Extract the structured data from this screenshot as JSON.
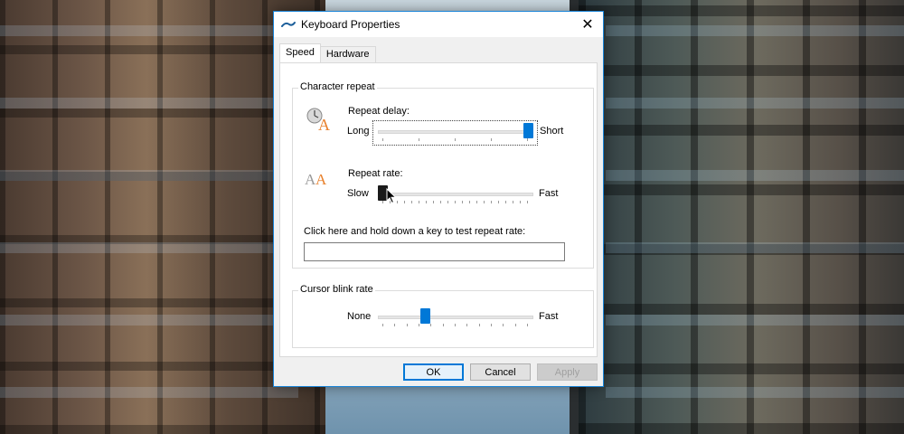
{
  "window": {
    "title": "Keyboard Properties",
    "close_glyph": "✕",
    "icon": "keyboard-icon"
  },
  "tabs": [
    {
      "label": "Speed",
      "active": true
    },
    {
      "label": "Hardware",
      "active": false
    }
  ],
  "character_repeat": {
    "group_label": "Character repeat",
    "repeat_delay": {
      "label": "Repeat delay:",
      "min_label": "Long",
      "max_label": "Short",
      "value": 1.0,
      "icon": "clock-letter-a-icon"
    },
    "repeat_rate": {
      "label": "Repeat rate:",
      "min_label": "Slow",
      "max_label": "Fast",
      "value": 0.0,
      "icon": "double-letter-a-icon"
    },
    "test_label": "Click here and hold down a key to test repeat rate:",
    "test_value": ""
  },
  "cursor_blink": {
    "group_label": "Cursor blink rate",
    "min_label": "None",
    "max_label": "Fast",
    "value": 0.29
  },
  "buttons": {
    "ok": "OK",
    "cancel": "Cancel",
    "apply": "Apply"
  },
  "colors": {
    "accent": "#0078d7",
    "title_border": "#1883d7",
    "icon_orange": "#e8812d"
  }
}
